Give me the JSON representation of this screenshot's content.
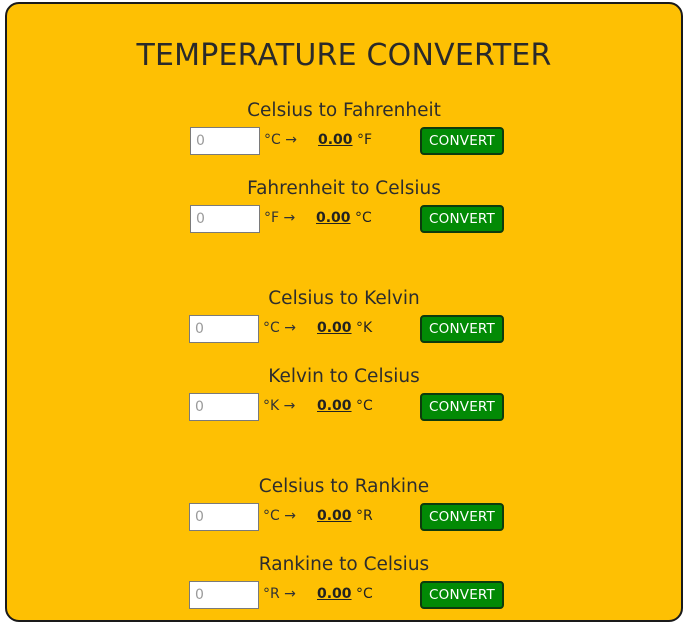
{
  "app": {
    "title": "TEMPERATURE CONVERTER"
  },
  "converters": [
    {
      "title": "Celsius to Fahrenheit",
      "input_placeholder": "0",
      "from_unit": "°C →",
      "result_value": "0.00",
      "to_unit": "°F",
      "button_label": "CONVERT"
    },
    {
      "title": "Fahrenheit to Celsius",
      "input_placeholder": "0",
      "from_unit": "°F →",
      "result_value": "0.00",
      "to_unit": "°C",
      "button_label": "CONVERT"
    },
    {
      "title": "Celsius to Kelvin",
      "input_placeholder": "0",
      "from_unit": "°C →",
      "result_value": "0.00",
      "to_unit": "°K",
      "button_label": "CONVERT"
    },
    {
      "title": "Kelvin to Celsius",
      "input_placeholder": "0",
      "from_unit": "°K →",
      "result_value": "0.00",
      "to_unit": "°C",
      "button_label": "CONVERT"
    },
    {
      "title": "Celsius to Rankine",
      "input_placeholder": "0",
      "from_unit": "°C →",
      "result_value": "0.00",
      "to_unit": "°R",
      "button_label": "CONVERT"
    },
    {
      "title": "Rankine to Celsius",
      "input_placeholder": "0",
      "from_unit": "°R →",
      "result_value": "0.00",
      "to_unit": "°C",
      "button_label": "CONVERT"
    }
  ],
  "colors": {
    "background": "#FEC003",
    "button": "#028A05",
    "button_text": "#FFFFFF"
  }
}
